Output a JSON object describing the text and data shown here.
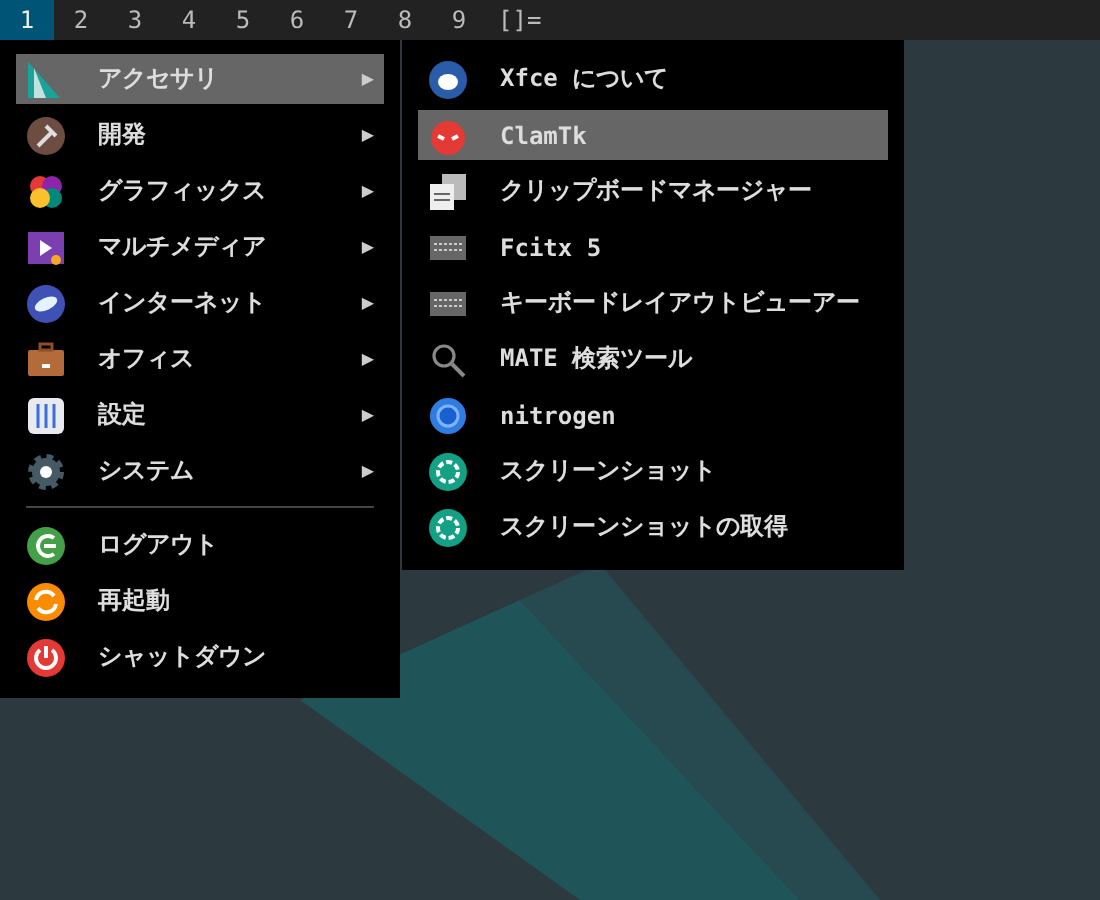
{
  "workspaces": [
    {
      "label": "1",
      "selected": true
    },
    {
      "label": "2",
      "selected": false
    },
    {
      "label": "3",
      "selected": false
    },
    {
      "label": "4",
      "selected": false
    },
    {
      "label": "5",
      "selected": false
    },
    {
      "label": "6",
      "selected": false
    },
    {
      "label": "7",
      "selected": false
    },
    {
      "label": "8",
      "selected": false
    },
    {
      "label": "9",
      "selected": false
    }
  ],
  "layout_symbol": "[]=",
  "menu": {
    "categories": [
      {
        "label": "アクセサリ",
        "kind": "accessories",
        "arrow": "▶",
        "selected": true
      },
      {
        "label": "開発",
        "kind": "development",
        "arrow": "▶",
        "selected": false
      },
      {
        "label": "グラフィックス",
        "kind": "graphics",
        "arrow": "▶",
        "selected": false
      },
      {
        "label": "マルチメディア",
        "kind": "multimedia",
        "arrow": "▶",
        "selected": false
      },
      {
        "label": "インターネット",
        "kind": "internet",
        "arrow": "▶",
        "selected": false
      },
      {
        "label": "オフィス",
        "kind": "office",
        "arrow": "▶",
        "selected": false
      },
      {
        "label": "設定",
        "kind": "settings",
        "arrow": "▶",
        "selected": false
      },
      {
        "label": "システム",
        "kind": "system",
        "arrow": "▶",
        "selected": false
      }
    ],
    "actions": [
      {
        "label": "ログアウト",
        "kind": "logout"
      },
      {
        "label": "再起動",
        "kind": "restart"
      },
      {
        "label": "シャットダウン",
        "kind": "shutdown"
      }
    ]
  },
  "submenu": {
    "items": [
      {
        "label": "Xfce について",
        "kind": "xfce",
        "selected": false
      },
      {
        "label": "ClamTk",
        "kind": "clamtk",
        "selected": true
      },
      {
        "label": "クリップボードマネージャー",
        "kind": "clipboard",
        "selected": false
      },
      {
        "label": "Fcitx 5",
        "kind": "keyboard",
        "selected": false
      },
      {
        "label": "キーボードレイアウトビューアー",
        "kind": "keyboard",
        "selected": false
      },
      {
        "label": "MATE 検索ツール",
        "kind": "search",
        "selected": false
      },
      {
        "label": "nitrogen",
        "kind": "nitrogen",
        "selected": false
      },
      {
        "label": "スクリーンショット",
        "kind": "screenshot",
        "selected": false
      },
      {
        "label": "スクリーンショットの取得",
        "kind": "screenshot",
        "selected": false
      }
    ]
  }
}
